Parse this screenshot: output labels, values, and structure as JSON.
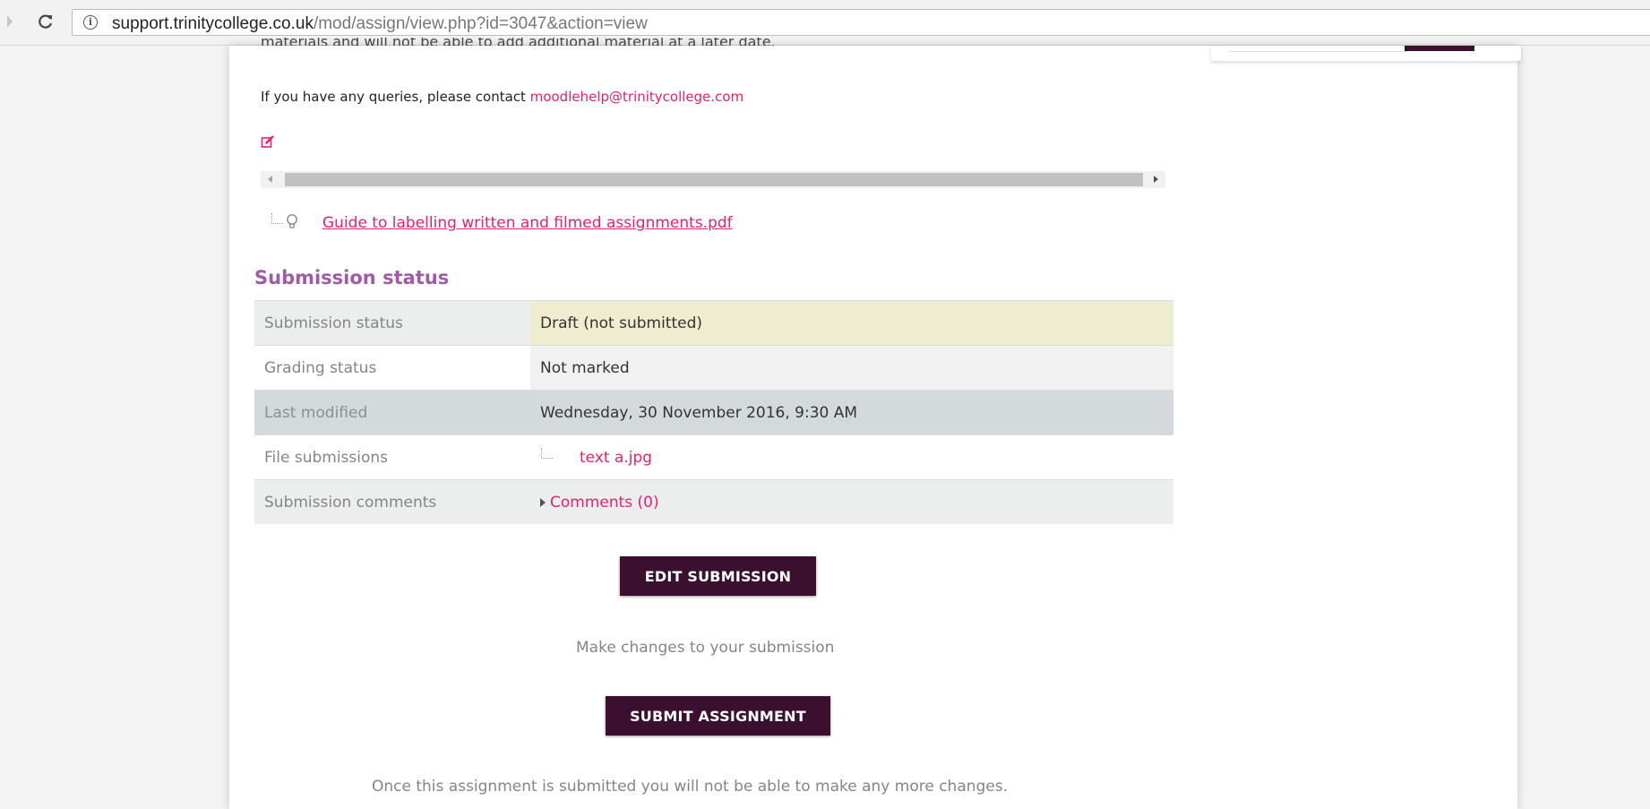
{
  "browser": {
    "url_host": "support.trinitycollege.co.uk",
    "url_path": "/mod/assign/view.php?id=3047&action=view"
  },
  "intro": {
    "cut_text": "materials and will not be able to add additional material at a later date.",
    "query_prefix": "If you have any queries, please contact ",
    "contact_email": "moodlehelp@trinitycollege.com",
    "attachment": "Guide to labelling written and filmed assignments.pdf"
  },
  "submission": {
    "title": "Submission status",
    "rows": [
      {
        "label": "Submission status",
        "value": "Draft (not submitted)"
      },
      {
        "label": "Grading status",
        "value": "Not marked"
      },
      {
        "label": "Last modified",
        "value": "Wednesday, 30 November 2016, 9:30 AM"
      },
      {
        "label": "File submissions",
        "value": "text a.jpg"
      },
      {
        "label": "Submission comments",
        "value": "Comments (0)"
      }
    ]
  },
  "actions": {
    "edit_label": "EDIT SUBMISSION",
    "edit_help": "Make changes to your submission",
    "submit_label": "SUBMIT ASSIGNMENT",
    "submit_help": "Once this assignment is submitted you will not be able to make any more changes."
  },
  "colors": {
    "accent_link": "#e6206e",
    "heading": "#a15aa6",
    "button": "#3a0f2f",
    "draft_highlight": "#f0ecd0"
  }
}
